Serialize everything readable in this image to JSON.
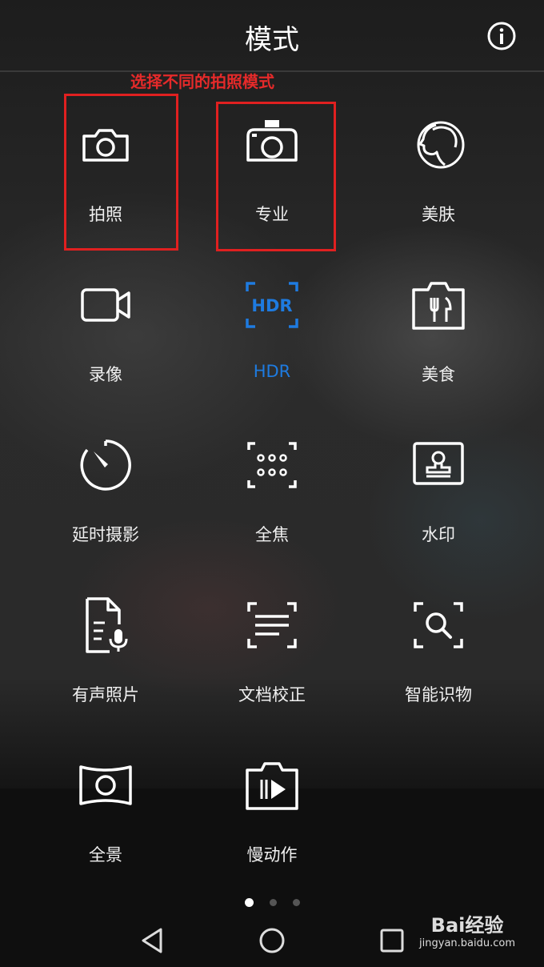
{
  "header": {
    "title": "模式"
  },
  "annotation": {
    "text": "选择不同的拍照模式"
  },
  "modes": [
    {
      "label": "拍照",
      "icon": "camera-icon"
    },
    {
      "label": "专业",
      "icon": "pro-camera-icon"
    },
    {
      "label": "美肤",
      "icon": "face-beauty-icon"
    },
    {
      "label": "录像",
      "icon": "video-icon"
    },
    {
      "label": "HDR",
      "icon": "hdr-icon",
      "active": true
    },
    {
      "label": "美食",
      "icon": "food-icon"
    },
    {
      "label": "延时摄影",
      "icon": "timelapse-icon"
    },
    {
      "label": "全焦",
      "icon": "all-focus-icon"
    },
    {
      "label": "水印",
      "icon": "watermark-icon"
    },
    {
      "label": "有声照片",
      "icon": "audio-photo-icon"
    },
    {
      "label": "文档校正",
      "icon": "document-scan-icon"
    },
    {
      "label": "智能识物",
      "icon": "smart-recognition-icon"
    },
    {
      "label": "全景",
      "icon": "panorama-icon"
    },
    {
      "label": "慢动作",
      "icon": "slow-motion-icon"
    }
  ],
  "pagination": {
    "current": 1,
    "total": 3
  },
  "watermark": {
    "brand": "Bai经验",
    "url": "jingyan.baidu.com"
  },
  "colors": {
    "accent": "#1e7be0",
    "annotation": "#e52a2a"
  }
}
